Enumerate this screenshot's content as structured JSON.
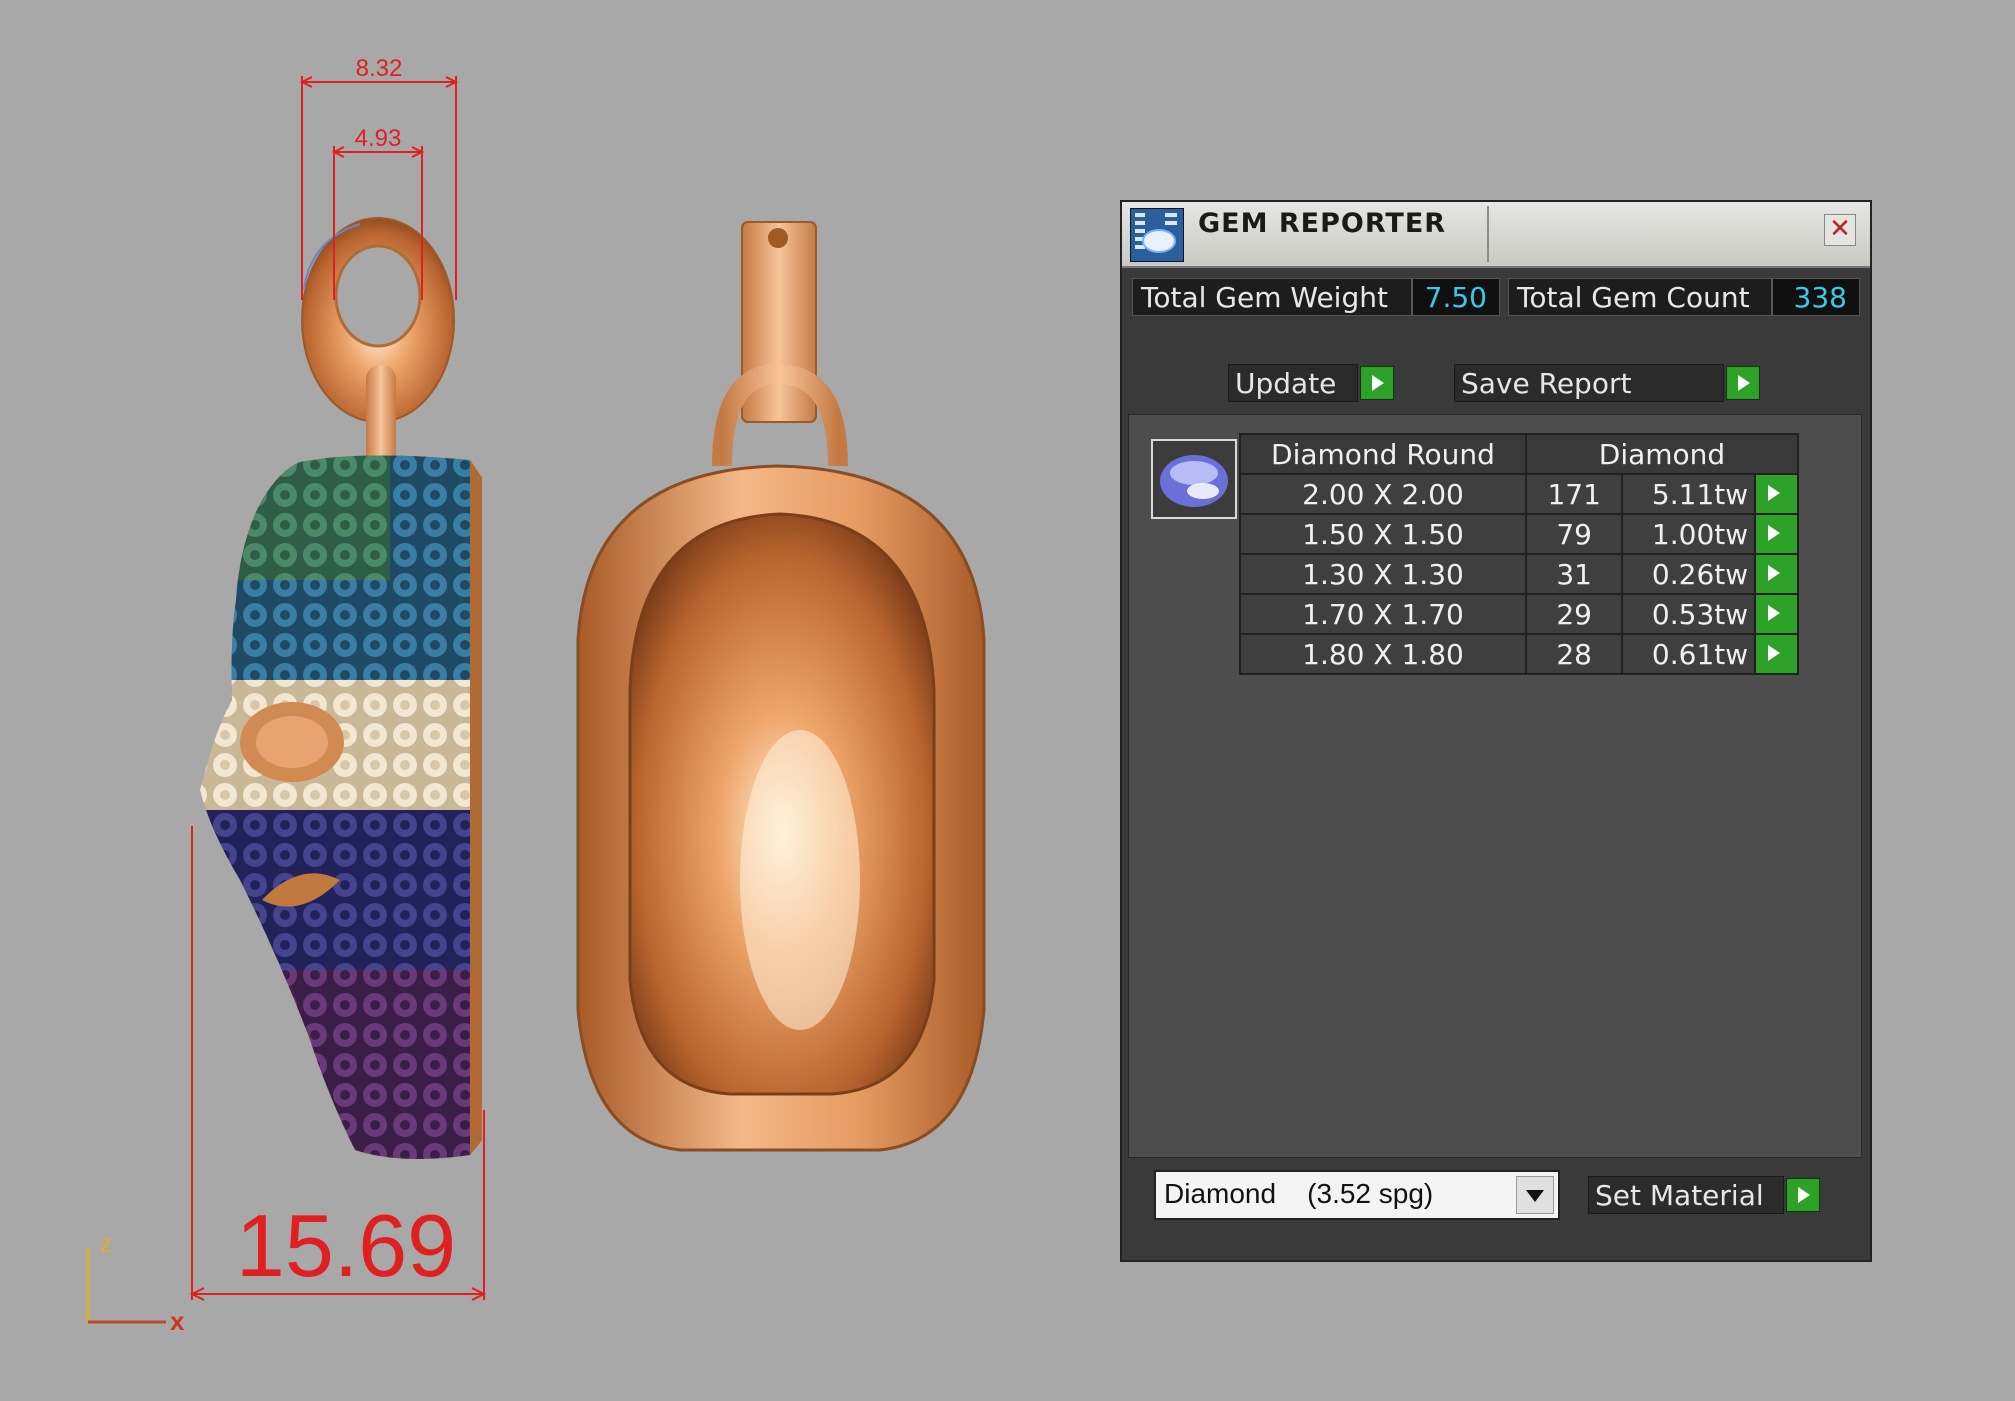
{
  "dimensions": {
    "total_width": "8.32",
    "inner_width": "4.93",
    "height": "15.69"
  },
  "axes": {
    "z_label": "z",
    "x_label": "x"
  },
  "gem_reporter": {
    "title": "GEM REPORTER",
    "total_weight_label": "Total Gem Weight",
    "total_weight_value": "7.50",
    "total_count_label": "Total Gem Count",
    "total_count_value": "338",
    "update_label": "Update",
    "save_report_label": "Save Report",
    "table": {
      "header_shape": "Diamond Round",
      "header_material": "Diamond",
      "rows": [
        {
          "size": "2.00 X 2.00",
          "count": "171",
          "weight": "5.11tw"
        },
        {
          "size": "1.50 X 1.50",
          "count": "79",
          "weight": "1.00tw"
        },
        {
          "size": "1.30 X 1.30",
          "count": "31",
          "weight": "0.26tw"
        },
        {
          "size": "1.70 X 1.70",
          "count": "29",
          "weight": "0.53tw"
        },
        {
          "size": "1.80 X 1.80",
          "count": "28",
          "weight": "0.61tw"
        }
      ]
    },
    "material_select": "Diamond    (3.52 spg)",
    "set_material_label": "Set Material"
  },
  "colors": {
    "gold": "#e8a06a",
    "dimension_red": "#e02020",
    "gem_green": "#3d7a5a",
    "gem_teal": "#2e6a88",
    "gem_cream": "#e8dcc0",
    "gem_navy": "#3a3a80",
    "gem_purple": "#5a3468",
    "value_cyan": "#3ec8e8",
    "button_green": "#2ea128"
  }
}
